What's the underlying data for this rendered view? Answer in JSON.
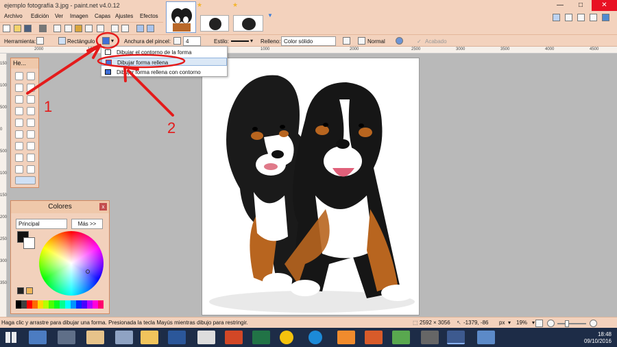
{
  "window": {
    "title": "ejemplo fotografía 3.jpg - paint.net v4.0.12",
    "minimize": "—",
    "maximize": "□",
    "close": "✕"
  },
  "menu": [
    "Archivo",
    "Edición",
    "Ver",
    "Imagen",
    "Capas",
    "Ajustes",
    "Efectos"
  ],
  "toolbar": {
    "herramienta_label": "Herramienta:",
    "shape_name": "Rectángulo",
    "anchura_label": "Anchura del pincel:",
    "anchura_value": "4",
    "estilo_label": "Estilo:",
    "relleno_label": "Relleno:",
    "relleno_value": "Color sólido",
    "blend_value": "Normal",
    "acabado": "Acabado"
  },
  "dropdown": {
    "items": [
      {
        "label": "Dibujar el contorno de la forma"
      },
      {
        "label": "Dibujar forma rellena"
      },
      {
        "label": "Dibujar forma rellena con contorno"
      }
    ]
  },
  "ruler": [
    "2000",
    "1000",
    "0",
    "1000",
    "2000",
    "2500",
    "3000",
    "3500",
    "4000",
    "4500"
  ],
  "vruler": [
    "1500",
    "1000",
    "500",
    "0",
    "500",
    "1000",
    "1500",
    "2000",
    "2500",
    "3000",
    "3500"
  ],
  "tools": {
    "title": "He..."
  },
  "colors": {
    "title": "Colores",
    "primary_select": "Principal",
    "more_button": "Más >>"
  },
  "annotations": {
    "one": "1",
    "two": "2"
  },
  "status": {
    "hint": "Haga clic y arrastre para dibujar una forma. Presionada la tecla Mayús mientras dibujo para restringir.",
    "size": "2592 × 3056",
    "coords": "-1379, -86",
    "unit": "px",
    "zoom": "19%"
  },
  "taskbar": {
    "time": "18:48",
    "date": "09/10/2016"
  },
  "colors_hex": {
    "accent_red": "#e41b1b",
    "selection": "#dbe8f6",
    "taskbar": "#1d2c47"
  }
}
